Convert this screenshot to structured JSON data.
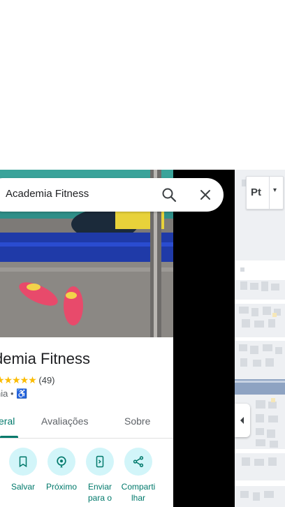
{
  "search": {
    "query": "Academia Fitness"
  },
  "place": {
    "title": "demia Fitness",
    "stars": "★★★★★",
    "review_count": "(49)",
    "category": "nia •",
    "accessibility_icon": "♿"
  },
  "tabs": [
    {
      "label": "eral"
    },
    {
      "label": "Avaliações"
    },
    {
      "label": "Sobre"
    }
  ],
  "actions": [
    {
      "label": "Salvar",
      "icon": "bookmark-icon"
    },
    {
      "label": "Próximo",
      "icon": "nearby-icon"
    },
    {
      "label": "Enviar para o",
      "icon": "send-to-phone-icon"
    },
    {
      "label": "Comparti lhar",
      "icon": "share-icon"
    }
  ],
  "map_controls": {
    "layer_label": "Pt",
    "caret": "▾"
  },
  "colors": {
    "accent": "#00796b",
    "action_bg": "#d2f5f9",
    "star": "#fbbc04"
  }
}
